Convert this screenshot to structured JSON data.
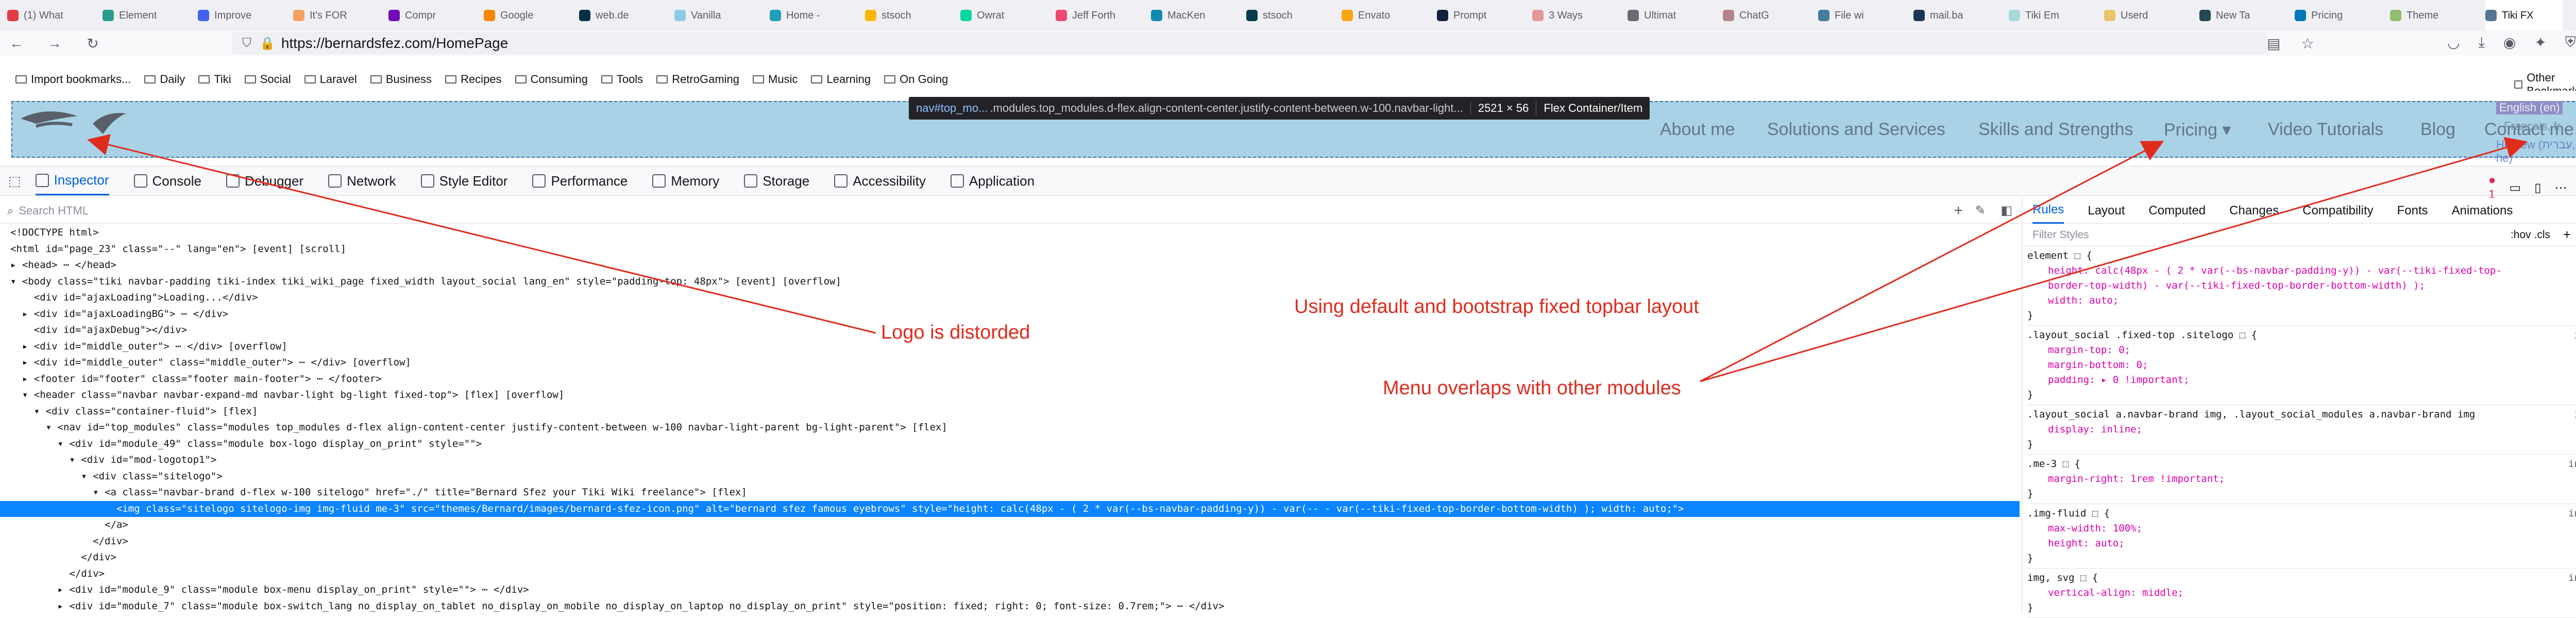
{
  "browser": {
    "tabs": [
      "(1) What",
      "Element",
      "Improve",
      "It's FOR",
      "Compr",
      "Google",
      "web.de",
      "Vanilla",
      "Home -",
      "stsoch",
      "Owrat",
      "Jeff Forth",
      "MacKen",
      "stsoch",
      "Envato",
      "Prompt",
      "3 Ways",
      "Ultimat",
      "ChatG",
      "File wi",
      "mail.ba",
      "Tiki Em",
      "Userd",
      "New Ta",
      "Pricing",
      "Theme",
      "Tiki FX"
    ],
    "url": "https://bernardsfez.com/HomePage",
    "bookmarks": [
      "Import bookmarks...",
      "Daily",
      "Tiki",
      "Social",
      "Laravel",
      "Business",
      "Recipes",
      "Consuming",
      "Tools",
      "RetroGaming",
      "Music",
      "Learning",
      "On Going"
    ],
    "other_bookmarks": "Other Bookmarks"
  },
  "site": {
    "menu": [
      "About me",
      "Solutions and Services",
      "Skills and Strengths",
      "Pricing ▾",
      "Video Tutorials",
      "Blog",
      "Contact me"
    ],
    "languages": [
      "English (en)",
      "Hebrew (עברית, he)"
    ],
    "lang_extra": "Français, fr",
    "infobox": {
      "sel": "nav#top_mo...",
      "cls": ".modules.top_modules.d-flex.align-content-center.justify-content-between.w-100.navbar-light...",
      "size": "2521 × 56",
      "kind": "Flex Container/Item"
    }
  },
  "devtools": {
    "tabs": [
      "Inspector",
      "Console",
      "Debugger",
      "Network",
      "Style Editor",
      "Performance",
      "Memory",
      "Storage",
      "Accessibility",
      "Application"
    ],
    "error_count": "1",
    "search_placeholder": "Search HTML",
    "right_tabs": [
      "Rules",
      "Layout",
      "Computed",
      "Changes",
      "Compatibility",
      "Fonts",
      "Animations"
    ],
    "filter_placeholder": "Filter Styles",
    "filter_tools": ":hov .cls",
    "html_lines": [
      "<!DOCTYPE html>",
      "<html id=\"page_23\" class=\"--\" lang=\"en\"> [event] [scroll]",
      "▸ <head> ⋯ </head>",
      "▾ <body class=\"tiki navbar-padding tiki-index tiki_wiki_page fixed_width layout_social lang_en\" style=\"padding-top: 48px\"> [event] [overflow]",
      "    <div id=\"ajaxLoading\">Loading...</div>",
      "  ▸ <div id=\"ajaxLoadingBG\"> ⋯ </div>",
      "    <div id=\"ajaxDebug\"></div>",
      "  ▸ <div id=\"middle_outer\"> ⋯ </div> [overflow]",
      "  ▸ <div id=\"middle_outer\" class=\"middle_outer\"> ⋯ </div> [overflow]",
      "  ▸ <footer id=\"footer\" class=\"footer main-footer\"> ⋯ </footer>",
      "  ▾ <header class=\"navbar navbar-expand-md navbar-light bg-light fixed-top\"> [flex] [overflow]",
      "    ▾ <div class=\"container-fluid\"> [flex]",
      "      ▾ <nav id=\"top_modules\" class=\"modules top_modules d-flex align-content-center justify-content-between w-100 navbar-light-parent bg-light-parent\"> [flex]",
      "        ▾ <div id=\"module_49\" class=\"module box-logo display_on_print\" style=\"\">",
      "          ▾ <div id=\"mod-logotop1\">",
      "            ▾ <div class=\"sitelogo\">",
      "              ▾ <a class=\"navbar-brand d-flex w-100 sitelogo\" href=\"./\" title=\"Bernard Sfez your Tiki Wiki freelance\"> [flex]",
      "                  <img class=\"sitelogo sitelogo-img img-fluid me-3\" src=\"themes/Bernard/images/bernard-sfez-icon.png\" alt=\"bernard sfez famous eyebrows\" style=\"height: calc(48px - ( 2 * var(--bs-navbar-padding-y)) - var(-- - var(--tiki-fixed-top-border-bottom-width) ); width: auto;\">",
      "                </a>",
      "              </div>",
      "            </div>",
      "          </div>",
      "        ▸ <div id=\"module_9\" class=\"module box-menu display_on_print\" style=\"\"> ⋯ </div>",
      "        ▸ <div id=\"module_7\" class=\"module box-switch_lang no_display_on_tablet no_display_on_mobile no_display_on_laptop no_display_on_print\" style=\"position: fixed; right: 0; font-size: 0.7rem;\"> ⋯ </div>",
      "        </nav>"
    ],
    "rules": [
      {
        "sel": "element ⬚ {",
        "src": "inline",
        "props": [
          "height: calc(48px - ( 2 * var(--bs-navbar-padding-y)) - var(--tiki-fixed-top-",
          "  border-top-width) - var(--tiki-fixed-top-border-bottom-width) );",
          "width: auto;"
        ]
      },
      {
        "sel": ".layout_social .fixed-top .sitelogo ⬚ {",
        "src": "inline:3",
        "props": [
          "margin-top: 0;",
          "margin-bottom: 0;",
          "padding: ▸ 0 !important;"
        ]
      },
      {
        "sel": ".layout_social a.navbar-brand img, .layout_social_modules a.navbar-brand img",
        "src": "inline:3",
        "props": [
          "display: inline;"
        ]
      },
      {
        "sel": ".me-3 ⬚ {",
        "src": "inline:15",
        "props": [
          "margin-right: 1rem !important;"
        ]
      },
      {
        "sel": ".img-fluid ⬚ {",
        "src": "inline:15",
        "props": [
          "max-width: 100%;",
          "height: auto;"
        ]
      },
      {
        "sel": "img, svg ⬚ {",
        "src": "inline:15",
        "props": [
          "vertical-align: middle;"
        ]
      }
    ]
  },
  "annotations": {
    "logo": "Logo is distorded",
    "layout": "Using default and bootstrap fixed topbar layout",
    "menu": "Menu overlaps with other modules"
  }
}
